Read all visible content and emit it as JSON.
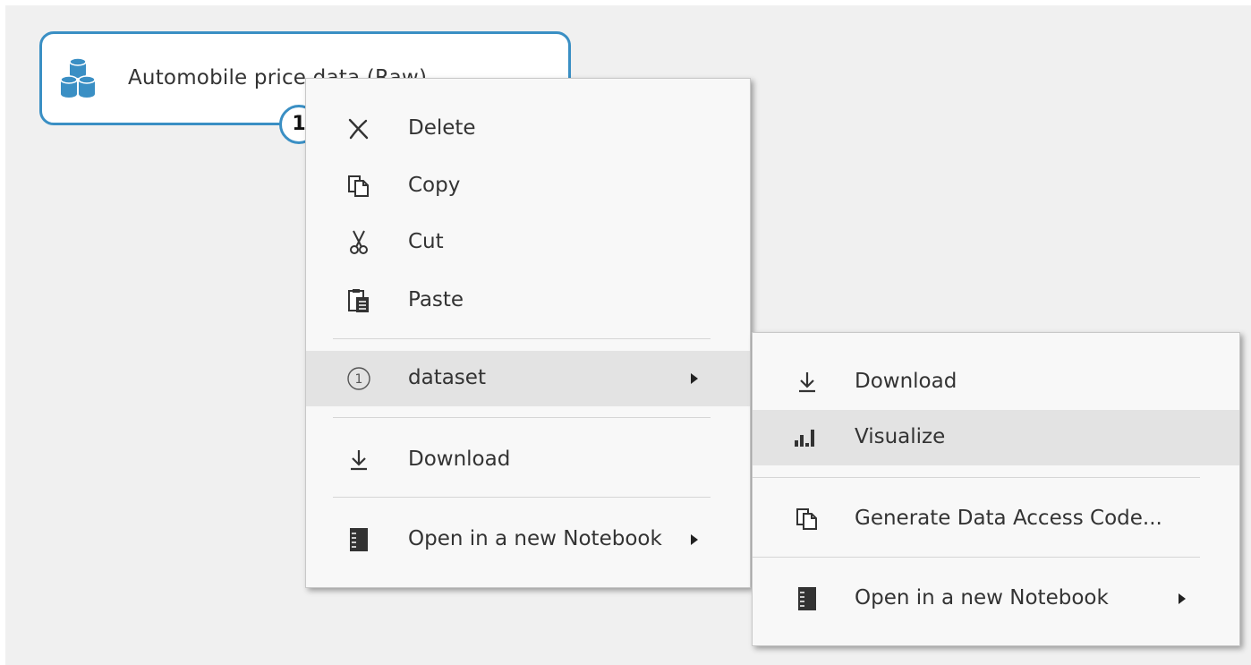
{
  "node": {
    "title": "Automobile price data (Raw)",
    "icon": "database-stack-icon",
    "port_number": "1"
  },
  "context_menu": {
    "items": [
      {
        "label": "Delete",
        "icon": "delete-x-icon"
      },
      {
        "label": "Copy",
        "icon": "copy-icon"
      },
      {
        "label": "Cut",
        "icon": "scissors-icon"
      },
      {
        "label": "Paste",
        "icon": "paste-icon"
      },
      {
        "label": "dataset",
        "icon": "circled-number-icon",
        "icon_text": "1",
        "has_submenu": true,
        "highlighted": true
      },
      {
        "label": "Download",
        "icon": "download-icon"
      },
      {
        "label": "Open in a new Notebook",
        "icon": "notebook-icon",
        "has_submenu": true
      }
    ]
  },
  "submenu": {
    "items": [
      {
        "label": "Download",
        "icon": "download-icon"
      },
      {
        "label": "Visualize",
        "icon": "bar-chart-icon",
        "highlighted": true
      },
      {
        "label": "Generate Data Access Code...",
        "icon": "copy-icon"
      },
      {
        "label": "Open in a new Notebook",
        "icon": "notebook-icon",
        "has_submenu": true
      }
    ]
  },
  "colors": {
    "node_border": "#3a8fc4",
    "icon_blue": "#3a8fc4",
    "highlight": "#e3e3e3",
    "canvas": "#f0f0f0"
  }
}
